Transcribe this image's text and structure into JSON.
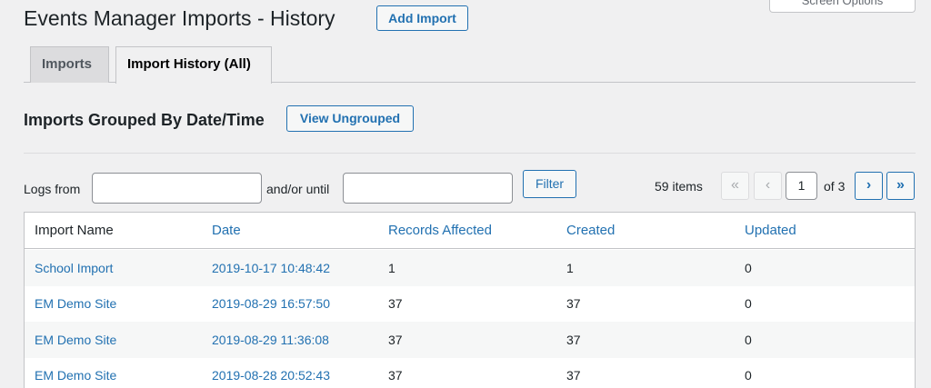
{
  "screen_options": "Screen Options",
  "header": {
    "title": "Events Manager Imports - History",
    "add_button": "Add Import"
  },
  "tabs": [
    {
      "label": "Imports",
      "active": false
    },
    {
      "label": "Import History (All)",
      "active": true
    }
  ],
  "section": {
    "title": "Imports Grouped By Date/Time",
    "ungrouped_button": "View Ungrouped"
  },
  "filter": {
    "from_label": "Logs from",
    "from_value": "",
    "until_label": "and/or until",
    "until_value": "",
    "button": "Filter"
  },
  "pagination": {
    "items": "59 items",
    "first": "«",
    "prev": "‹",
    "current": "1",
    "of_total": "of 3",
    "next": "›",
    "last": "»"
  },
  "table": {
    "headers": [
      "Import Name",
      "Date",
      "Records Affected",
      "Created",
      "Updated"
    ],
    "rows": [
      {
        "name": "School Import",
        "date": "2019-10-17 10:48:42",
        "affected": "1",
        "created": "1",
        "updated": "0"
      },
      {
        "name": "EM Demo Site",
        "date": "2019-08-29 16:57:50",
        "affected": "37",
        "created": "37",
        "updated": "0"
      },
      {
        "name": "EM Demo Site",
        "date": "2019-08-29 11:36:08",
        "affected": "37",
        "created": "37",
        "updated": "0"
      },
      {
        "name": "EM Demo Site",
        "date": "2019-08-28 20:52:43",
        "affected": "37",
        "created": "37",
        "updated": "0"
      }
    ]
  },
  "colors": {
    "link": "#2271b1",
    "background": "#f0f0f1"
  }
}
